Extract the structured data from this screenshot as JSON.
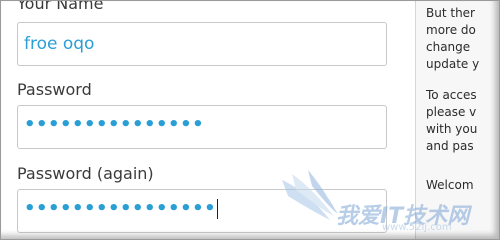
{
  "form": {
    "name_label": "Your Name",
    "name_value": "froe oqo",
    "password_label": "Password",
    "password_masked": "•••••••••••••••",
    "password_again_label": "Password (again)",
    "password_again_masked": "••••••••••••••••"
  },
  "sidebar": {
    "lines": [
      "But ther",
      "more do",
      "change",
      "update y",
      "To acces",
      "please v",
      "with you",
      "and pas",
      "Welcom"
    ]
  },
  "watermark": {
    "text": "我爱IT技术网",
    "url": "www.52ij.com"
  },
  "colors": {
    "input_text": "#2a9fd6",
    "label_text": "#3b3b3b"
  }
}
